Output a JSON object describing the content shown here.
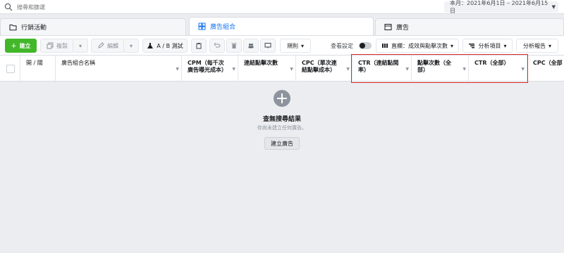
{
  "search": {
    "placeholder": "搜尋和篩選"
  },
  "date_range": {
    "label": "本月：2021年6月1日 – 2021年6月15日"
  },
  "tabs": [
    {
      "label": "行銷活動"
    },
    {
      "label": "廣告組合"
    },
    {
      "label": "廣告"
    }
  ],
  "toolbar": {
    "create_label": "建立",
    "duplicate_label": "複製",
    "edit_label": "編輯",
    "ab_test_label": "A / B 測試",
    "rules_label": "規則",
    "view_settings_label": "查看設定",
    "columns_label": "直欄：成效與點擊次數",
    "breakdown_label": "分析項目",
    "reports_label": "分析報告"
  },
  "table": {
    "columns": [
      {
        "label": "開 / 關"
      },
      {
        "label": "廣告組合名稱"
      },
      {
        "label": "CPM（每千次廣告曝光成本）"
      },
      {
        "label": "連結點擊次數"
      },
      {
        "label": "CPC（單次連結點擊成本）"
      },
      {
        "label": "CTR（連結點閱率）"
      },
      {
        "label": "點擊次數（全部）"
      },
      {
        "label": "CTR（全部）"
      },
      {
        "label": "CPC（全部"
      }
    ]
  },
  "empty_state": {
    "title": "查無搜尋結果",
    "subtitle": "你尚未建立任何廣告。",
    "button_label": "建立廣告"
  }
}
